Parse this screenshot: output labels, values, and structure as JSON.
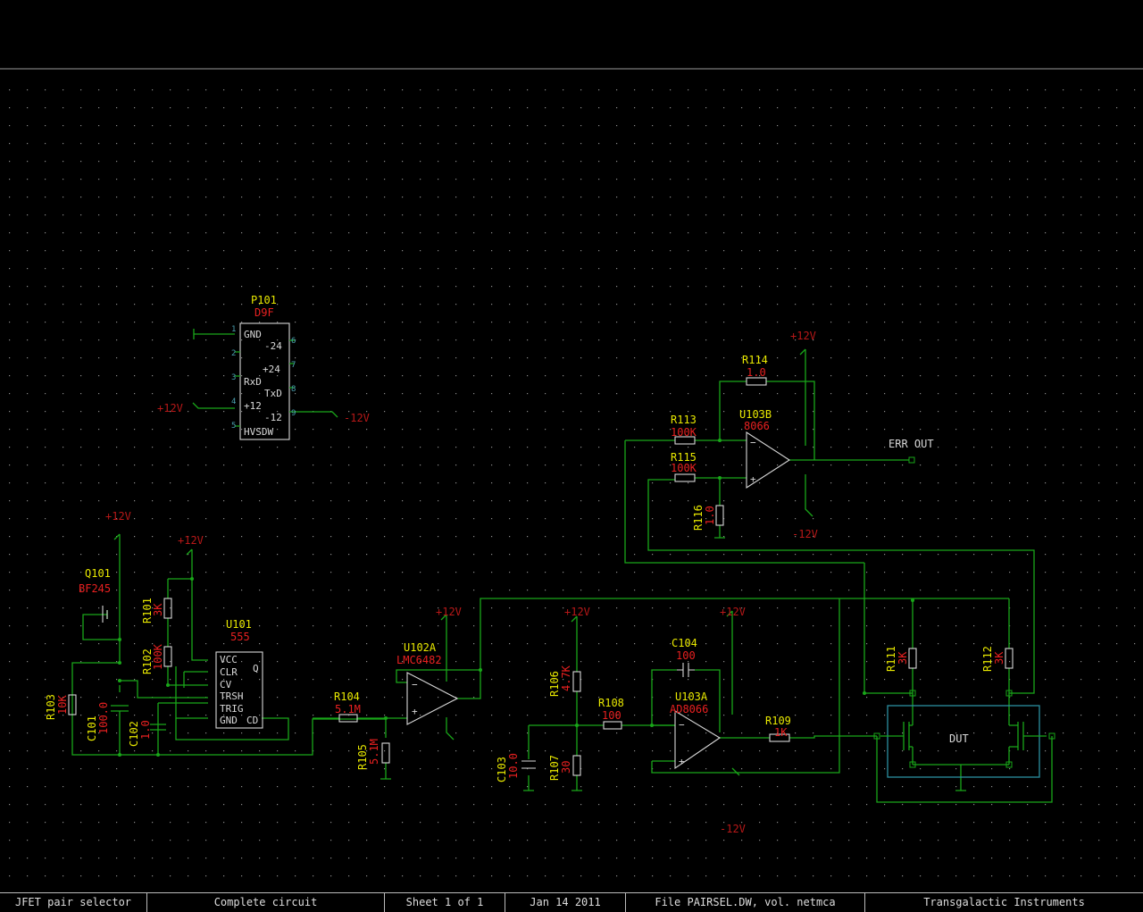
{
  "title_block": {
    "project": "JFET pair selector",
    "page": "Complete circuit",
    "sheet": "Sheet 1 of 1",
    "date": "Jan 14 2011",
    "file": "File PAIRSEL.DW, vol. netmca",
    "company": "Transgalactic Instruments"
  },
  "rails": {
    "pos": "+12V",
    "neg": "-12V"
  },
  "parts": {
    "p101": {
      "ref": "P101",
      "value": "D9F",
      "pins": {
        "gnd": "GND",
        "m24": "-24",
        "p24": "+24",
        "rxd": "RxD",
        "txd": "TxD",
        "p12": "+12",
        "m12": "-12",
        "hvsdw": "HVSDW"
      },
      "pin_numbers": [
        "1",
        "2",
        "3",
        "4",
        "5",
        "6",
        "7",
        "8",
        "9"
      ]
    },
    "q101": {
      "ref": "Q101",
      "value": "BF245"
    },
    "r101": {
      "ref": "R101",
      "value": "3K"
    },
    "r102": {
      "ref": "R102",
      "value": "100K"
    },
    "r103": {
      "ref": "R103",
      "value": "10K"
    },
    "c101": {
      "ref": "C101",
      "value": "100.0"
    },
    "c102": {
      "ref": "C102",
      "value": "1.0"
    },
    "u101": {
      "ref": "U101",
      "value": "555",
      "pins": {
        "vcc": "VCC",
        "clr": "CLR",
        "cv": "CV",
        "trsh": "TRSH",
        "trig": "TRIG",
        "gnd": "GND",
        "cd": "CD",
        "q": "Q"
      }
    },
    "r104": {
      "ref": "R104",
      "value": "5.1M"
    },
    "r105": {
      "ref": "R105",
      "value": "5.1M"
    },
    "u102a": {
      "ref": "U102A",
      "value": "LMC6482"
    },
    "r106": {
      "ref": "R106",
      "value": "4.7K"
    },
    "r107": {
      "ref": "R107",
      "value": "30"
    },
    "r108": {
      "ref": "R108",
      "value": "100"
    },
    "c103": {
      "ref": "C103",
      "value": "10.0"
    },
    "c104": {
      "ref": "C104",
      "value": "100"
    },
    "u103a": {
      "ref": "U103A",
      "value": "AD8066"
    },
    "r109": {
      "ref": "R109",
      "value": "1K"
    },
    "r111": {
      "ref": "R111",
      "value": "3K"
    },
    "r112": {
      "ref": "R112",
      "value": "3K"
    },
    "r113": {
      "ref": "R113",
      "value": "100K"
    },
    "r114": {
      "ref": "R114",
      "value": "1.0"
    },
    "r115": {
      "ref": "R115",
      "value": "100K"
    },
    "r116": {
      "ref": "R116",
      "value": "1.0"
    },
    "u103b": {
      "ref": "U103B",
      "value": "8066"
    },
    "dut": {
      "ref": "DUT"
    },
    "err_out": {
      "label": "ERR OUT"
    }
  }
}
